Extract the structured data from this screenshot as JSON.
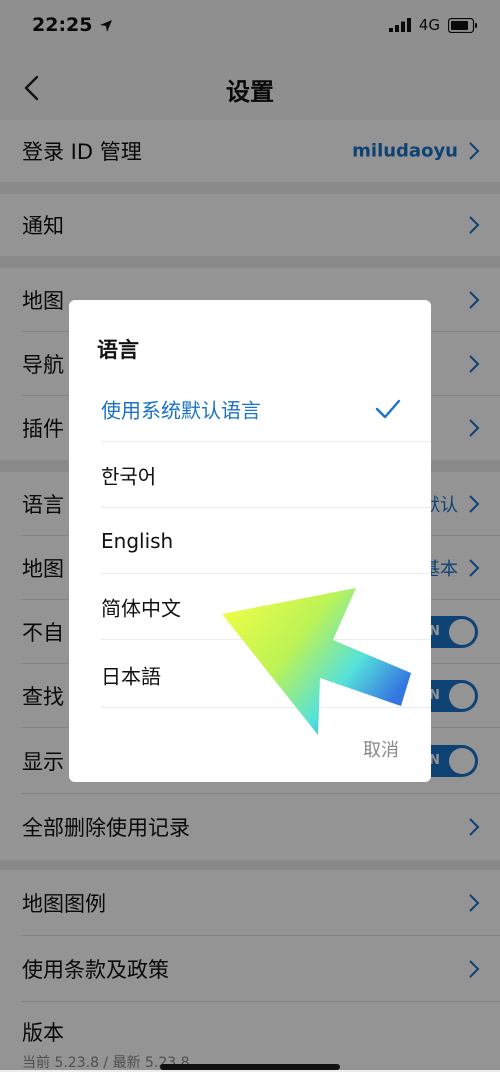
{
  "status": {
    "time": "22:25",
    "network": "4G"
  },
  "nav": {
    "title": "设置"
  },
  "settings": {
    "login_id": {
      "label": "登录 ID 管理",
      "value": "miludaoyu"
    },
    "notifications": {
      "label": "通知"
    },
    "map": {
      "label": "地图"
    },
    "navigation": {
      "label": "导航"
    },
    "plugins": {
      "label": "插件"
    },
    "language": {
      "label": "语言",
      "value": "默认"
    },
    "map_style": {
      "label": "地图",
      "value": "基本"
    },
    "no_sleep": {
      "label": "不自",
      "toggle": "ON"
    },
    "search": {
      "label": "查找",
      "toggle": "ON"
    },
    "display": {
      "label": "显示",
      "toggle": "ON"
    },
    "clear_history": {
      "label": "全部删除使用记录"
    },
    "map_legend": {
      "label": "地图图例"
    },
    "terms": {
      "label": "使用条款及政策"
    },
    "version": {
      "label": "版本",
      "detail": "当前 5.23.8 / 最新 5.23.8"
    }
  },
  "dialog": {
    "title": "语言",
    "options": [
      {
        "label": "使用系统默认语言",
        "selected": true
      },
      {
        "label": "한국어",
        "selected": false
      },
      {
        "label": "English",
        "selected": false
      },
      {
        "label": "简体中文",
        "selected": false
      },
      {
        "label": "日本語",
        "selected": false
      }
    ],
    "cancel": "取消"
  },
  "colors": {
    "accent": "#1a73c8",
    "overlay": "rgba(0,0,0,0.42)"
  },
  "icons": [
    "back-chevron-icon",
    "location-arrow-icon",
    "signal-icon",
    "battery-icon",
    "chevron-right-icon",
    "checkmark-icon",
    "pointer-arrow-annotation"
  ]
}
